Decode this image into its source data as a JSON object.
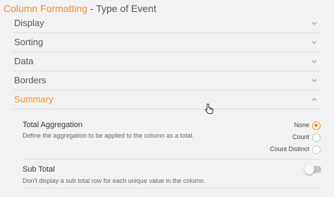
{
  "dialog": {
    "title_accent": "Column Formatting",
    "title_rest": " - Type of Event"
  },
  "accordion": {
    "items": [
      {
        "label": "Display"
      },
      {
        "label": "Sorting"
      },
      {
        "label": "Data"
      },
      {
        "label": "Borders"
      },
      {
        "label": "Summary",
        "expanded": true
      }
    ]
  },
  "summary": {
    "total_aggregation": {
      "label": "Total Aggregation",
      "description": "Define the aggregation to be applied to the column as a total.",
      "options": [
        {
          "label": "None",
          "selected": true
        },
        {
          "label": "Count",
          "selected": false
        },
        {
          "label": "Count Distinct",
          "selected": false
        }
      ]
    },
    "sub_total": {
      "label": "Sub Total",
      "description": "Don't display a sub total row for each unique value in the column.",
      "enabled": false
    }
  },
  "colors": {
    "accent": "#f0912c",
    "text": "#555555",
    "background": "#f2f2f2"
  },
  "icons": {
    "chevron": "chevron-down-icon",
    "chevron_expanded": "chevron-up-icon",
    "cursor": "hand-pointer-icon"
  }
}
